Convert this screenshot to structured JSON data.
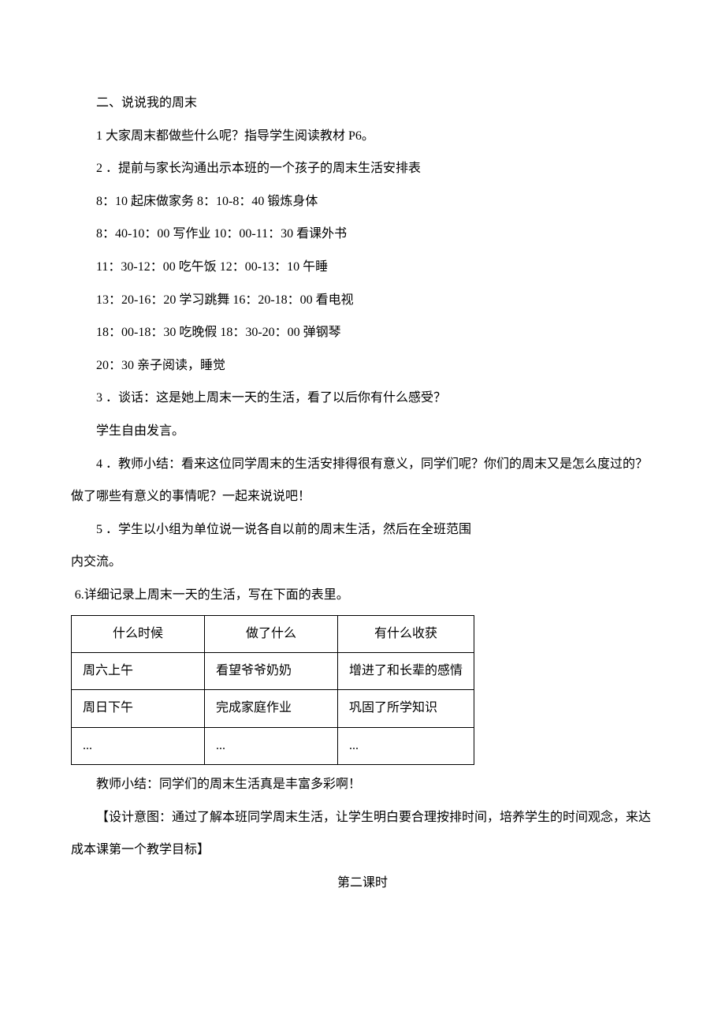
{
  "section_heading": "二、说说我的周末",
  "p1": "1 大家周末都做些什么呢？指导学生阅读教材 P6。",
  "p2": "2 ．提前与家长沟通出示本班的一个孩子的周末生活安排表",
  "schedule": {
    "line1": "8：10 起床做家务 8：10-8：40 锻炼身体",
    "line2": "8：40-10：00 写作业 10：00-11：30 看课外书",
    "line3": "11：30-12：00 吃午饭 12：00-13：10 午睡",
    "line4": "13：20-16：20 学习跳舞 16：20-18：00 看电视",
    "line5": "18：00-18：30 吃晚假 18：30-20：00 弹钢琴",
    "line6": "20：30 亲子阅读，睡觉"
  },
  "p3": "3 ．谈话：这是她上周末一天的生活，看了以后你有什么感受？",
  "p3b": "学生自由发言。",
  "p4": "4 ．教师小结：看来这位同学周末的生活安排得很有意义，同学们呢？你们的周末又是怎么度过的？做了哪些有意义的事情呢？一起来说说吧！",
  "p5": "5 ．学生以小组为单位说一说各自以前的周末生活，然后在全班范围",
  "p5b": "内交流。",
  "p6": "6.详细记录上周末一天的生活，写在下面的表里。",
  "table": {
    "header": {
      "c1": "什么时候",
      "c2": "做了什么",
      "c3": "有什么收获"
    },
    "row1": {
      "c1": "周六上午",
      "c2": "看望爷爷奶奶",
      "c3": "增进了和长辈的感情"
    },
    "row2": {
      "c1": "周日下午",
      "c2": "完成家庭作业",
      "c3": "巩固了所学知识"
    },
    "row3": {
      "c1": "...",
      "c2": "...",
      "c3": "..."
    }
  },
  "teacher_summary": "教师小结：同学们的周末生活真是丰富多彩啊！",
  "design_intent": "【设计意图：通过了解本班同学周末生活，让学生明白要合理按排时间，培养学生的时间观念，来达成本课第一个教学目标】",
  "second_class_title": "第二课时"
}
